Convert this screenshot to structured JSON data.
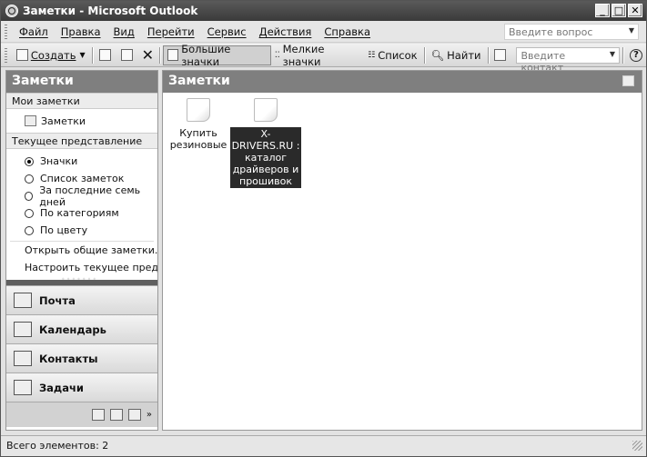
{
  "window": {
    "title": "Заметки - Microsoft Outlook"
  },
  "menu": {
    "items": [
      "Файл",
      "Правка",
      "Вид",
      "Перейти",
      "Сервис",
      "Действия",
      "Справка"
    ],
    "help_placeholder": "Введите вопрос"
  },
  "toolbar": {
    "new_label": "Создать",
    "large_icons_label": "Большие значки",
    "small_icons_label": "Мелкие значки",
    "list_label": "Список",
    "find_label": "Найти",
    "contact_placeholder": "Введите контакт"
  },
  "nav": {
    "header": "Заметки",
    "my_notes_section": "Мои заметки",
    "folder_label": "Заметки",
    "current_view_section": "Текущее представление",
    "views": [
      {
        "label": "Значки",
        "checked": true
      },
      {
        "label": "Список заметок",
        "checked": false
      },
      {
        "label": "За последние семь дней",
        "checked": false
      },
      {
        "label": "По категориям",
        "checked": false
      },
      {
        "label": "По цвету",
        "checked": false
      }
    ],
    "links": [
      "Открыть общие заметки...",
      "Настроить текущее представление..."
    ],
    "buttons": [
      "Почта",
      "Календарь",
      "Контакты",
      "Задачи"
    ]
  },
  "content": {
    "header": "Заметки",
    "notes": [
      {
        "label": "Купить резиновые",
        "selected": false
      },
      {
        "label": "X-DRIVERS.RU : каталог драйверов и прошивок",
        "selected": true
      }
    ]
  },
  "status": {
    "text": "Всего элементов: 2"
  }
}
